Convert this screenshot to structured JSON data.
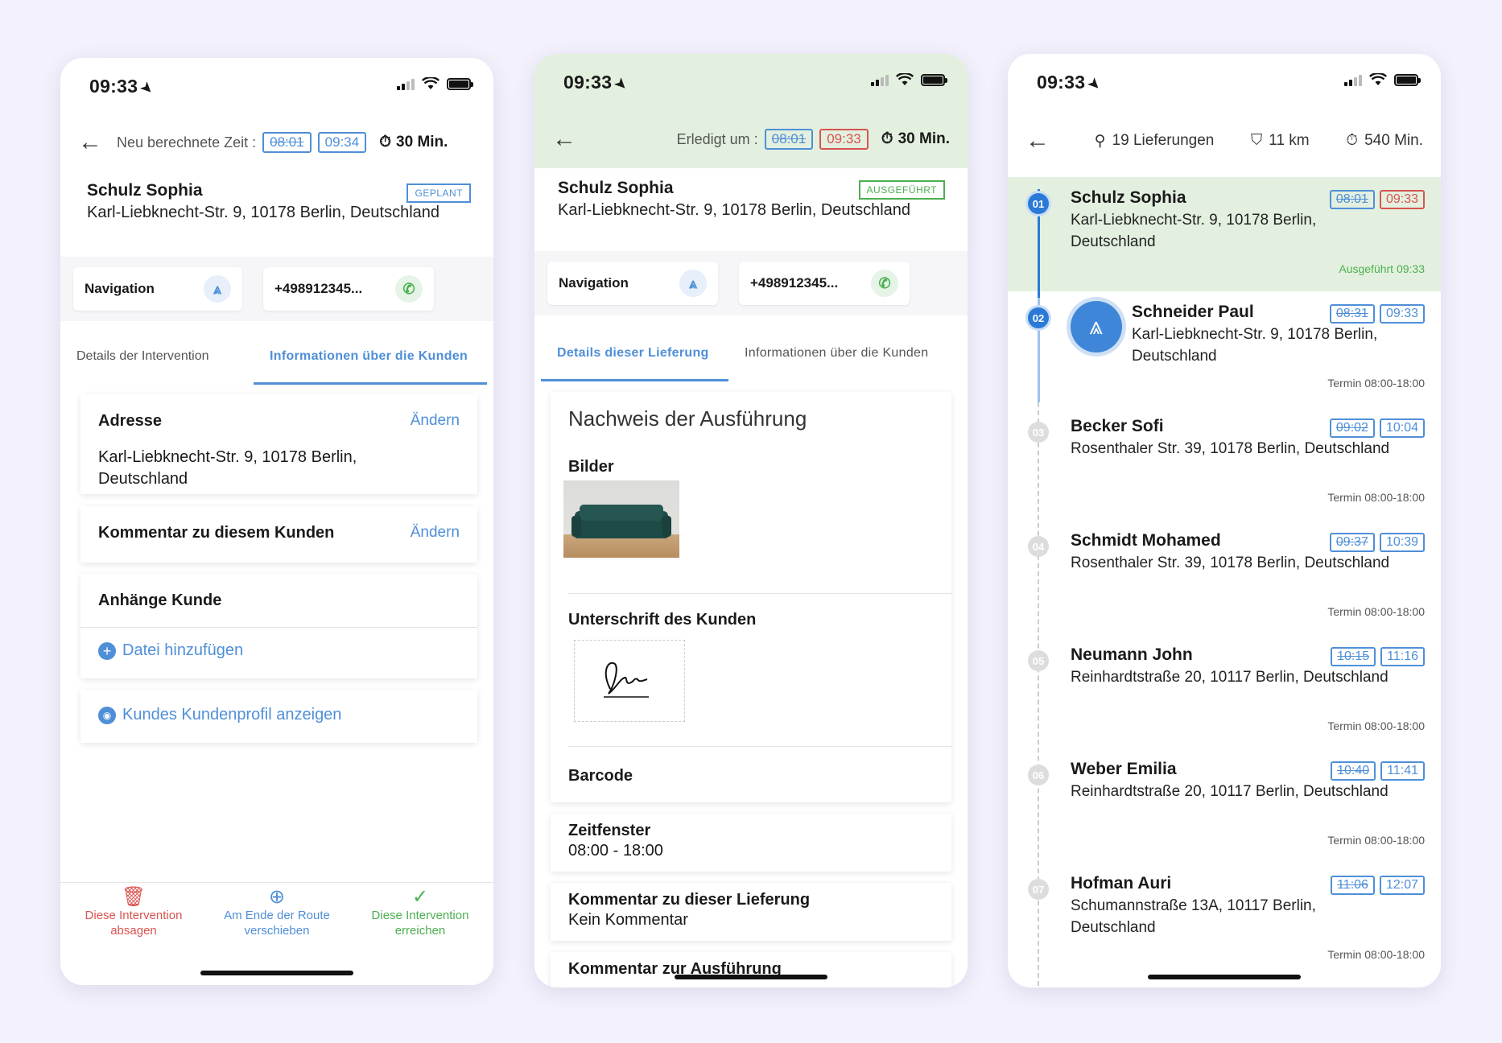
{
  "status": {
    "time": "09:33"
  },
  "screen1": {
    "header_label": "Neu berechnete Zeit :",
    "time_old": "08:01",
    "time_new": "09:34",
    "duration": "30 Min.",
    "customer_name": "Schulz Sophia",
    "customer_address": "Karl-Liebknecht-Str. 9, 10178 Berlin, Deutschland",
    "badge": "GEPLANT",
    "nav_label": "Navigation",
    "phone": "+498912345...",
    "tabs": [
      "Details der Intervention",
      "Informationen über die Kunden"
    ],
    "address_title": "Adresse",
    "edit_label": "Ändern",
    "address_value": "Karl-Liebknecht-Str. 9, 10178 Berlin, Deutschland",
    "comment_title": "Kommentar zu diesem Kunden",
    "attachments_title": "Anhänge Kunde",
    "add_file": "Datei hinzufügen",
    "view_profile": "Kundes Kundenprofil anzeigen",
    "bottom": {
      "cancel": "Diese Intervention absagen",
      "move": "Am Ende der Route verschieben",
      "reach": "Diese Intervention erreichen"
    }
  },
  "screen2": {
    "header_label": "Erledigt um :",
    "time_old": "08:01",
    "time_new": "09:33",
    "duration": "30 Min.",
    "customer_name": "Schulz Sophia",
    "customer_address": "Karl-Liebknecht-Str. 9, 10178 Berlin, Deutschland",
    "badge": "AUSGEFÜHRT",
    "nav_label": "Navigation",
    "phone": "+498912345...",
    "tabs": [
      "Details dieser Lieferung",
      "Informationen über die Kunden"
    ],
    "proof_title": "Nachweis der Ausführung",
    "images_title": "Bilder",
    "signature_title": "Unterschrift des Kunden",
    "barcode_title": "Barcode",
    "window_title": "Zeitfenster",
    "window_value": "08:00 - 18:00",
    "delivery_comment_title": "Kommentar zu dieser Lieferung",
    "delivery_comment_value": "Kein Kommentar",
    "execution_comment_title": "Kommentar zur Ausführung"
  },
  "screen3": {
    "deliveries": "19 Lieferungen",
    "distance": "11 km",
    "total_time": "540 Min.",
    "items": [
      {
        "num": "01",
        "name": "Schulz Sophia",
        "address": "Karl-Liebknecht-Str. 9, 10178 Berlin, Deutschland",
        "old": "08:01",
        "new": "09:33",
        "status": "Ausgeführt 09:33"
      },
      {
        "num": "02",
        "name": "Schneider Paul",
        "address": "Karl-Liebknecht-Str. 9, 10178 Berlin, Deutschland",
        "old": "08:31",
        "new": "09:33",
        "status": "Termin 08:00-18:00"
      },
      {
        "num": "03",
        "name": "Becker Sofi",
        "address": "Rosenthaler Str. 39, 10178 Berlin, Deutschland",
        "old": "09:02",
        "new": "10:04",
        "status": "Termin 08:00-18:00"
      },
      {
        "num": "04",
        "name": "Schmidt Mohamed",
        "address": "Rosenthaler Str. 39, 10178 Berlin, Deutschland",
        "old": "09:37",
        "new": "10:39",
        "status": "Termin 08:00-18:00"
      },
      {
        "num": "05",
        "name": "Neumann John",
        "address": "Reinhardtstraße 20, 10117 Berlin, Deutschland",
        "old": "10:15",
        "new": "11:16",
        "status": "Termin 08:00-18:00"
      },
      {
        "num": "06",
        "name": "Weber Emilia",
        "address": "Reinhardtstraße 20, 10117 Berlin, Deutschland",
        "old": "10:40",
        "new": "11:41",
        "status": "Termin 08:00-18:00"
      },
      {
        "num": "07",
        "name": "Hofman Auri",
        "address": "Schumannstraße 13A, 10117 Berlin, Deutschland",
        "old": "11:06",
        "new": "12:07",
        "status": "Termin 08:00-18:00"
      }
    ]
  },
  "colors": {
    "accent": "#4f8fd8",
    "done_green": "#e3f0df",
    "cancel_red": "#d9534f",
    "success_green": "#4caf50"
  }
}
